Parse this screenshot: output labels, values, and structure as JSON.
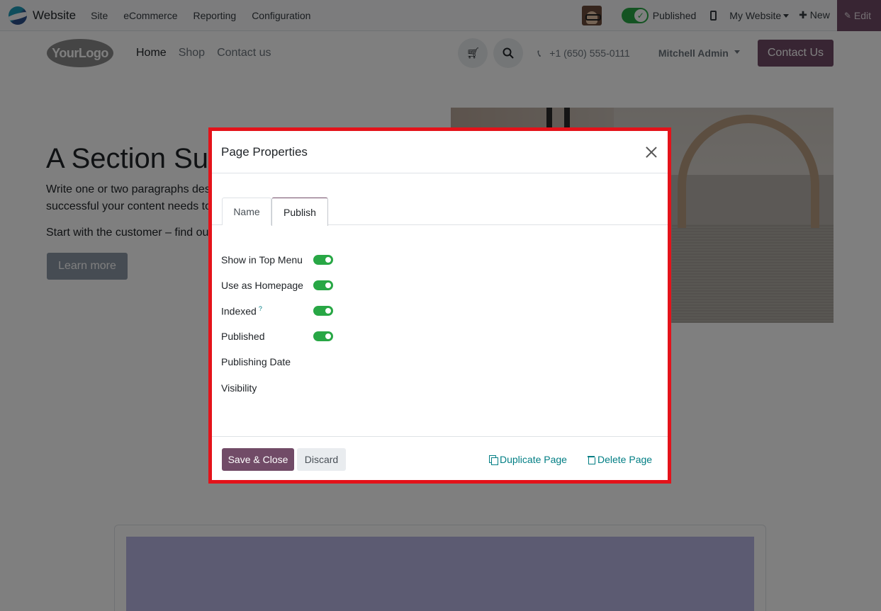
{
  "systray": {
    "app_name": "Website",
    "menu": [
      "Site",
      "eCommerce",
      "Reporting",
      "Configuration"
    ],
    "published_label": "Published",
    "my_website_label": "My Website",
    "new_label": "New",
    "edit_label": "Edit"
  },
  "site": {
    "logo_text": "YourLogo",
    "nav": [
      "Home",
      "Shop",
      "Contact us"
    ],
    "phone": "+1 (650) 555-0111",
    "user": "Mitchell Admin",
    "contact_button": "Contact Us"
  },
  "hero": {
    "title": "A Section Sul",
    "paragraph1_line1": "Write one or two paragraphs des",
    "paragraph1_line2": "successful your content needs to",
    "paragraph2": "Start with the customer – find ou",
    "button": "Learn more"
  },
  "modal": {
    "title": "Page Properties",
    "tabs": [
      "Name",
      "Publish"
    ],
    "active_tab": "Publish",
    "fields": [
      {
        "label": "Show in Top Menu",
        "toggle": true,
        "on": true
      },
      {
        "label": "Use as Homepage",
        "toggle": true,
        "on": true
      },
      {
        "label": "Indexed",
        "help": "?",
        "toggle": true,
        "on": true
      },
      {
        "label": "Published",
        "toggle": true,
        "on": true
      },
      {
        "label": "Publishing Date",
        "toggle": false
      },
      {
        "label": "Visibility",
        "toggle": false
      }
    ],
    "footer": {
      "save": "Save & Close",
      "discard": "Discard",
      "duplicate": "Duplicate Page",
      "delete": "Delete Page"
    }
  },
  "colors": {
    "brand": "#714b67",
    "toggle_on": "#28a745",
    "link": "#017e84",
    "highlight": "#e4121a"
  }
}
